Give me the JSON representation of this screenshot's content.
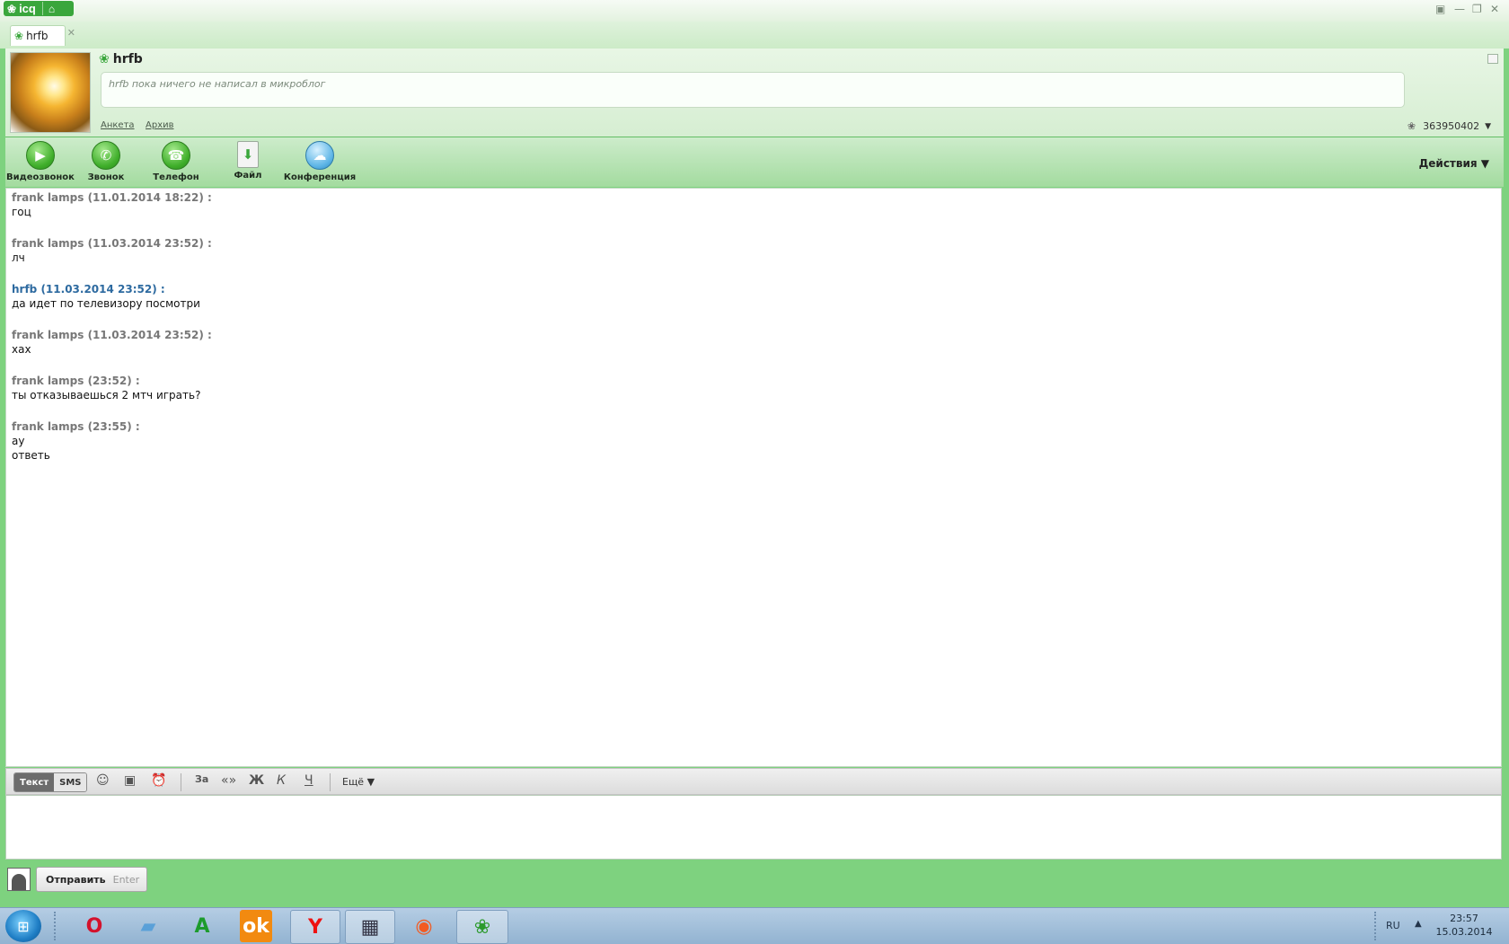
{
  "app": {
    "logo_text": "icq",
    "window_controls": [
      "▣",
      "—",
      "❐",
      "✕"
    ]
  },
  "tab": {
    "label": "hrfb",
    "close": "✕"
  },
  "profile": {
    "name": "hrfb",
    "microblog": "hrfb пока ничего не написал в микроблог",
    "links": {
      "anketa": "Анкета",
      "archive": "Архив"
    },
    "uin": "363950402",
    "uin_arrow": "▼"
  },
  "toolbar": {
    "buttons": [
      {
        "label": "Видеозвонок",
        "icon": "video-call-icon"
      },
      {
        "label": "Звонок",
        "icon": "phone-icon"
      },
      {
        "label": "Телефон",
        "icon": "telephone-icon"
      },
      {
        "label": "Файл",
        "icon": "file-icon"
      },
      {
        "label": "Конференция",
        "icon": "conference-icon"
      }
    ],
    "actions": "Действия ▼"
  },
  "messages": [
    {
      "header": "frank lamps (11.01.2014 18:22) :",
      "lines": [
        "гоц"
      ],
      "self": false
    },
    {
      "header": "frank lamps (11.03.2014 23:52) :",
      "lines": [
        "лч"
      ],
      "self": false
    },
    {
      "header": "hrfb (11.03.2014 23:52) :",
      "lines": [
        "да идет по телевизору посмотри"
      ],
      "self": true
    },
    {
      "header": "frank lamps (11.03.2014 23:52) :",
      "lines": [
        "хах"
      ],
      "self": false
    },
    {
      "header": "frank lamps (23:52) :",
      "lines": [
        "ты отказываешься 2 мтч играть?"
      ],
      "self": false
    },
    {
      "header": "frank lamps (23:55) :",
      "lines": [
        "ау",
        "ответь"
      ],
      "self": false
    }
  ],
  "format": {
    "mode_text": "Текст",
    "mode_sms": "SMS",
    "bold": "Ж",
    "italic": "К",
    "underline": "Ч",
    "quote": "«»",
    "translit": "За",
    "more": "Ещё ▼"
  },
  "send": {
    "label": "Отправить",
    "key": "Enter"
  },
  "taskbar": {
    "lang": "RU",
    "time": "23:57",
    "date": "15.03.2014",
    "tray_arrow": "▲"
  }
}
